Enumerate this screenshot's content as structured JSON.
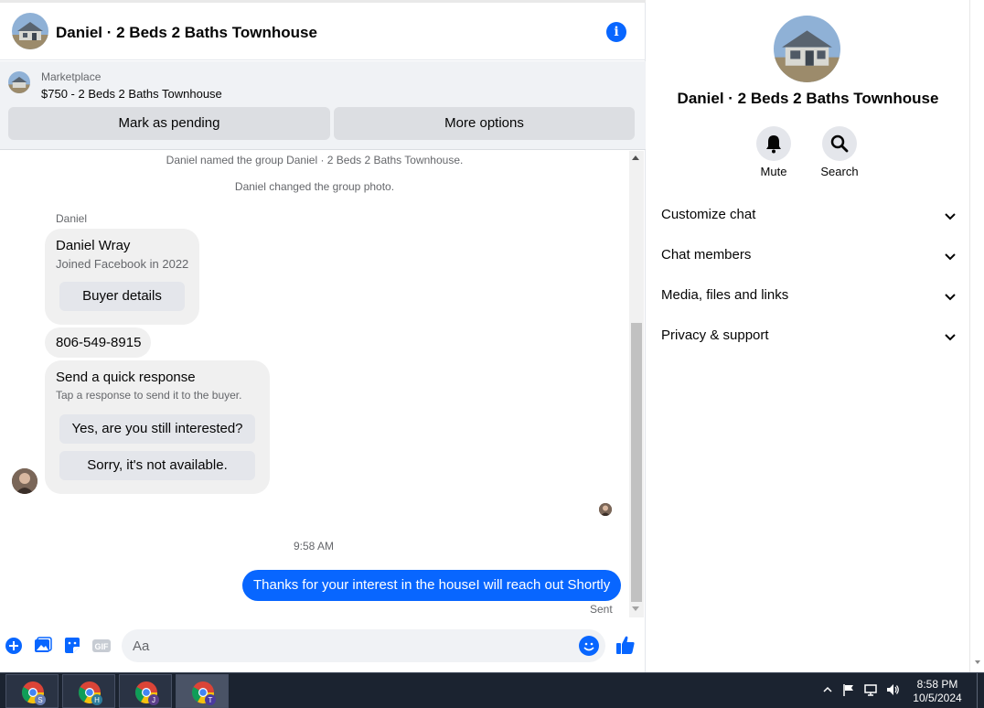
{
  "chat": {
    "header_title": "Daniel · 2 Beds 2 Baths Townhouse",
    "marketplace_label": "Marketplace",
    "listing": "$750 - 2 Beds 2 Baths Townhouse",
    "mark_pending": "Mark as pending",
    "more_options": "More options"
  },
  "messages": {
    "system_1": "Daniel named the group Daniel · 2 Beds 2 Baths Townhouse.",
    "system_2": "Daniel changed the group photo.",
    "sender": "Daniel",
    "profile_name": "Daniel Wray",
    "profile_joined": "Joined Facebook in 2022",
    "buyer_details": "Buyer details",
    "phone": "806-549-8915",
    "quick_title": "Send a quick response",
    "quick_sub": "Tap a response to send it to the buyer.",
    "quick_1": "Yes, are you still interested?",
    "quick_2": "Sorry, it's not available.",
    "time": "9:58 AM",
    "outgoing": "Thanks for your interest in the houseI will reach out Shortly",
    "status": "Sent"
  },
  "composer": {
    "placeholder": "Aa",
    "gif_label": "GIF"
  },
  "info_panel": {
    "title": "Daniel · 2 Beds 2 Baths Townhouse",
    "mute": "Mute",
    "search": "Search",
    "sections": [
      "Customize chat",
      "Chat members",
      "Media, files and links",
      "Privacy & support"
    ]
  },
  "taskbar": {
    "apps": [
      {
        "badge": "S"
      },
      {
        "badge": "H"
      },
      {
        "badge": "J"
      },
      {
        "badge": "T"
      }
    ],
    "time": "8:58 PM",
    "date": "10/5/2024"
  },
  "colors": {
    "accent": "#0866ff",
    "bubble": "#f0f0f0",
    "taskbar": "#1b2330"
  }
}
